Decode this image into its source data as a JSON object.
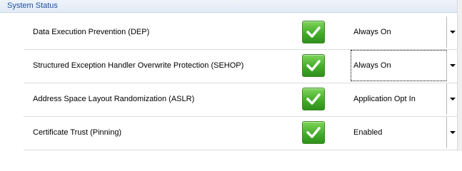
{
  "section": {
    "title": "System Status"
  },
  "icons": {
    "status": "check-icon"
  },
  "colors": {
    "header_text": "#1f4f9c",
    "check_green": "#45ad2a"
  },
  "rows": [
    {
      "label": "Data Execution Prevention (DEP)",
      "value": "Always On"
    },
    {
      "label": "Structured Exception Handler Overwrite Protection (SEHOP)",
      "value": "Always On"
    },
    {
      "label": "Address Space Layout Randomization (ASLR)",
      "value": "Application Opt In"
    },
    {
      "label": "Certificate Trust (Pinning)",
      "value": "Enabled"
    }
  ]
}
